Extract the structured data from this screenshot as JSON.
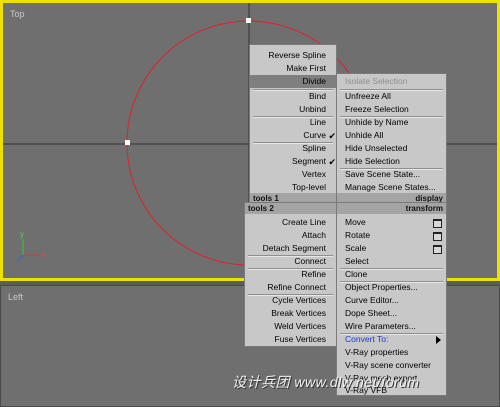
{
  "viewports": {
    "top_label": "Top",
    "left_label": "Left"
  },
  "axis": {
    "x": "x",
    "y": "y"
  },
  "menu_left_upper": {
    "items": [
      {
        "label": "Reverse Spline"
      },
      {
        "label": "Make First"
      },
      {
        "label": "Divide"
      },
      {
        "label": "Bind"
      },
      {
        "label": "Unbind"
      },
      {
        "label": "Line"
      },
      {
        "label": "Curve"
      },
      {
        "label": "Spline"
      },
      {
        "label": "Segment"
      },
      {
        "label": "Vertex"
      },
      {
        "label": "Top-level"
      }
    ],
    "header": "tools 1"
  },
  "menu_right_upper": {
    "items": [
      {
        "label": "Isolate Selection"
      },
      {
        "label": "Unfreeze All"
      },
      {
        "label": "Freeze Selection"
      },
      {
        "label": "Unhide by Name"
      },
      {
        "label": "Unhide All"
      },
      {
        "label": "Hide Unselected"
      },
      {
        "label": "Hide Selection"
      },
      {
        "label": "Save Scene State..."
      },
      {
        "label": "Manage Scene States..."
      }
    ],
    "header": "display"
  },
  "menu_left_lower": {
    "header": "tools 2",
    "items": [
      {
        "label": "Create Line"
      },
      {
        "label": "Attach"
      },
      {
        "label": "Detach Segment"
      },
      {
        "label": "Connect"
      },
      {
        "label": "Refine"
      },
      {
        "label": "Refine Connect"
      },
      {
        "label": "Cycle Vertices"
      },
      {
        "label": "Break Vertices"
      },
      {
        "label": "Weld Vertices"
      },
      {
        "label": "Fuse Vertices"
      }
    ]
  },
  "menu_right_lower": {
    "header": "transform",
    "items": [
      {
        "label": "Move"
      },
      {
        "label": "Rotate"
      },
      {
        "label": "Scale"
      },
      {
        "label": "Select"
      },
      {
        "label": "Clone"
      },
      {
        "label": "Object Properties..."
      },
      {
        "label": "Curve Editor..."
      },
      {
        "label": "Dope Sheet..."
      },
      {
        "label": "Wire Parameters..."
      },
      {
        "label": "Convert To:"
      },
      {
        "label": "V-Ray properties"
      },
      {
        "label": "V-Ray scene converter"
      },
      {
        "label": "V-Ray mesh export"
      },
      {
        "label": "V-Ray VFB"
      }
    ]
  },
  "watermark": "设计兵团  www.dlw.net/forum",
  "colors": {
    "viewport_border_active": "#f0e000",
    "spline": "#e0202a",
    "menu_bg": "#c8c8c8"
  }
}
